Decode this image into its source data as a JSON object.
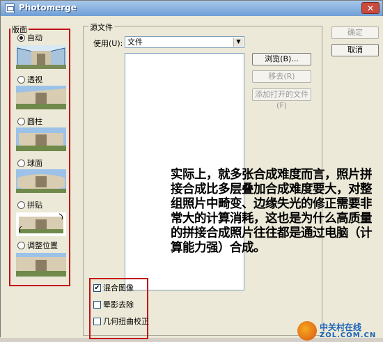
{
  "window": {
    "title": "Photomerge",
    "close_glyph": "✕"
  },
  "layout": {
    "group_label": "版面",
    "options": [
      {
        "label": "自动",
        "selected": true
      },
      {
        "label": "透视",
        "selected": false
      },
      {
        "label": "圆柱",
        "selected": false
      },
      {
        "label": "球面",
        "selected": false
      },
      {
        "label": "拼贴",
        "selected": false
      },
      {
        "label": "调整位置",
        "selected": false
      }
    ]
  },
  "source": {
    "group_label": "源文件",
    "use_label": "使用(U):",
    "use_value": "文件",
    "browse_button": "浏览(B)...",
    "remove_button": "移去(R)",
    "add_open_button": "添加打开的文件(F)"
  },
  "options": {
    "blend_images": {
      "label": "混合图像",
      "checked": true
    },
    "vignette_removal": {
      "label": "晕影去除",
      "checked": false
    },
    "geometric_distortion": {
      "label": "几何扭曲校正",
      "checked": false
    }
  },
  "dialog_buttons": {
    "ok": "确定",
    "cancel": "取消"
  },
  "annotation": {
    "text": "实际上，就多张合成难度而言，照片拼接合成比多层叠加合成难度要大，对整组照片中畸变、边缘失光的修正需要非常大的计算消耗，这也是为什么高质量的拼接合成照片往往都是通过电脑（计算能力强）合成。"
  },
  "watermark": {
    "line1": "中关村在线",
    "line2": "ZOL.COM.CN"
  },
  "colors": {
    "highlight_border": "#c20e15",
    "dialog_bg": "#ece9d8",
    "title_bar": "#6f9fd6"
  }
}
